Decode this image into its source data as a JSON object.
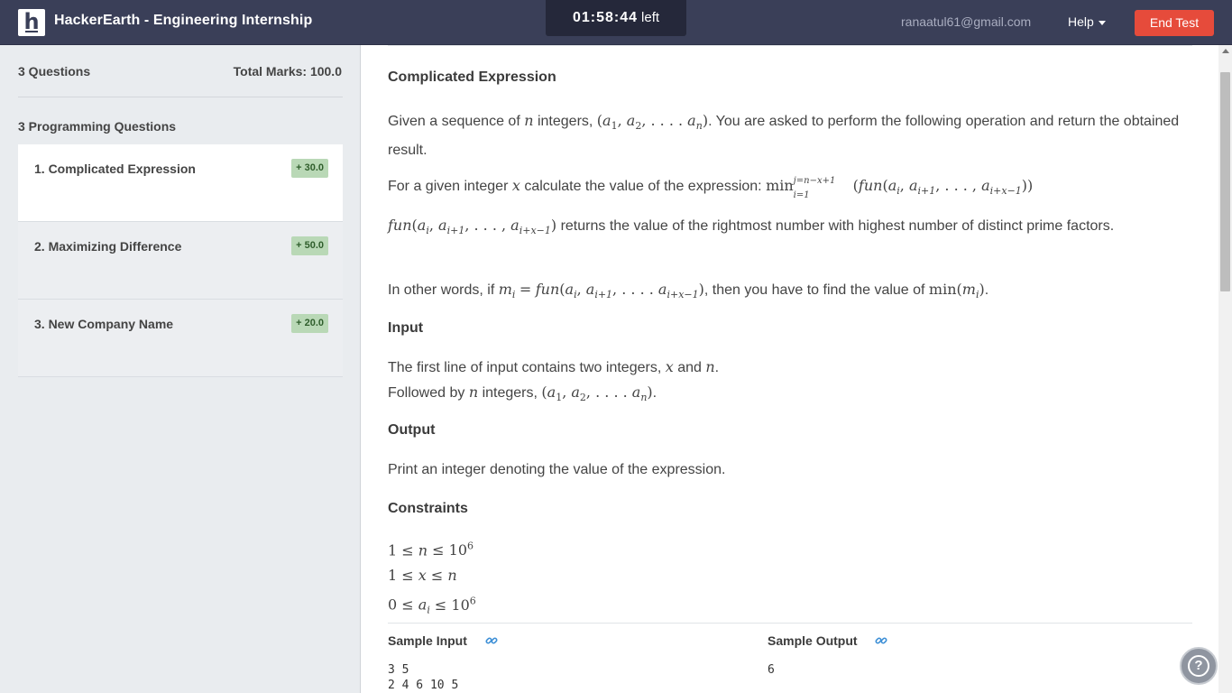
{
  "header": {
    "logo_letter": "h",
    "title": "HackerEarth - Engineering Internship",
    "timer": "01:58:44",
    "timer_suffix": "left",
    "email": "ranaatul61@gmail.com",
    "help_label": "Help",
    "end_test_label": "End Test"
  },
  "sidebar": {
    "question_count": "3 Questions",
    "total_marks": "Total Marks: 100.0",
    "section_title": "3 Programming Questions",
    "questions": [
      {
        "label": "1. Complicated Expression",
        "marks": "+ 30.0"
      },
      {
        "label": "2. Maximizing Difference",
        "marks": "+ 50.0"
      },
      {
        "label": "3. New Company Name",
        "marks": "+ 20.0"
      }
    ]
  },
  "problem": {
    "title": "Complicated Expression",
    "input_heading": "Input",
    "output_heading": "Output",
    "constraints_heading": "Constraints",
    "output_text": "Print an integer denoting the value of the expression.",
    "sample_input_heading": "Sample Input",
    "sample_output_heading": "Sample Output",
    "sample_input_line1": "3 5",
    "sample_input_line2": "2 4 6 10 5",
    "sample_output": "6"
  },
  "colors": {
    "header_bg": "#3a3f58",
    "end_test": "#e64b3b",
    "badge_bg": "#b9d8b6"
  }
}
